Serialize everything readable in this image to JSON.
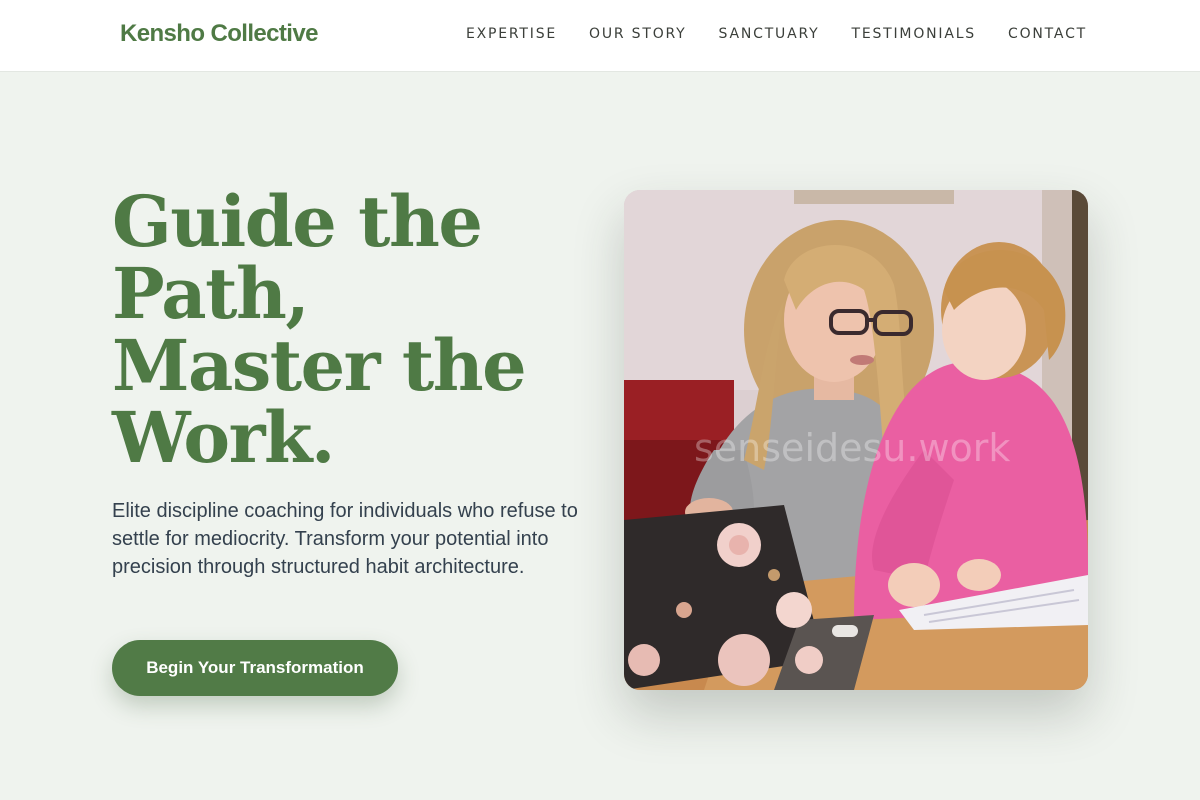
{
  "header": {
    "brand": "Kensho Collective",
    "nav": [
      "EXPERTISE",
      "OUR STORY",
      "SANCTUARY",
      "TESTIMONIALS",
      "CONTACT"
    ]
  },
  "hero": {
    "title_lines": [
      "Guide the",
      "Path,",
      "Master the",
      "Work."
    ],
    "description": "Elite discipline coaching for individuals who refuse to settle for mediocrity. Transform your potential into precision through structured habit architecture.",
    "cta_label": "Begin Your Transformation"
  },
  "photo": {
    "watermark": "senseidesu.work",
    "subject": "woman-and-child-studying-at-laptop"
  },
  "colors": {
    "accent": "#4f7a45",
    "background": "#eff3ee",
    "text": "#34414e"
  }
}
